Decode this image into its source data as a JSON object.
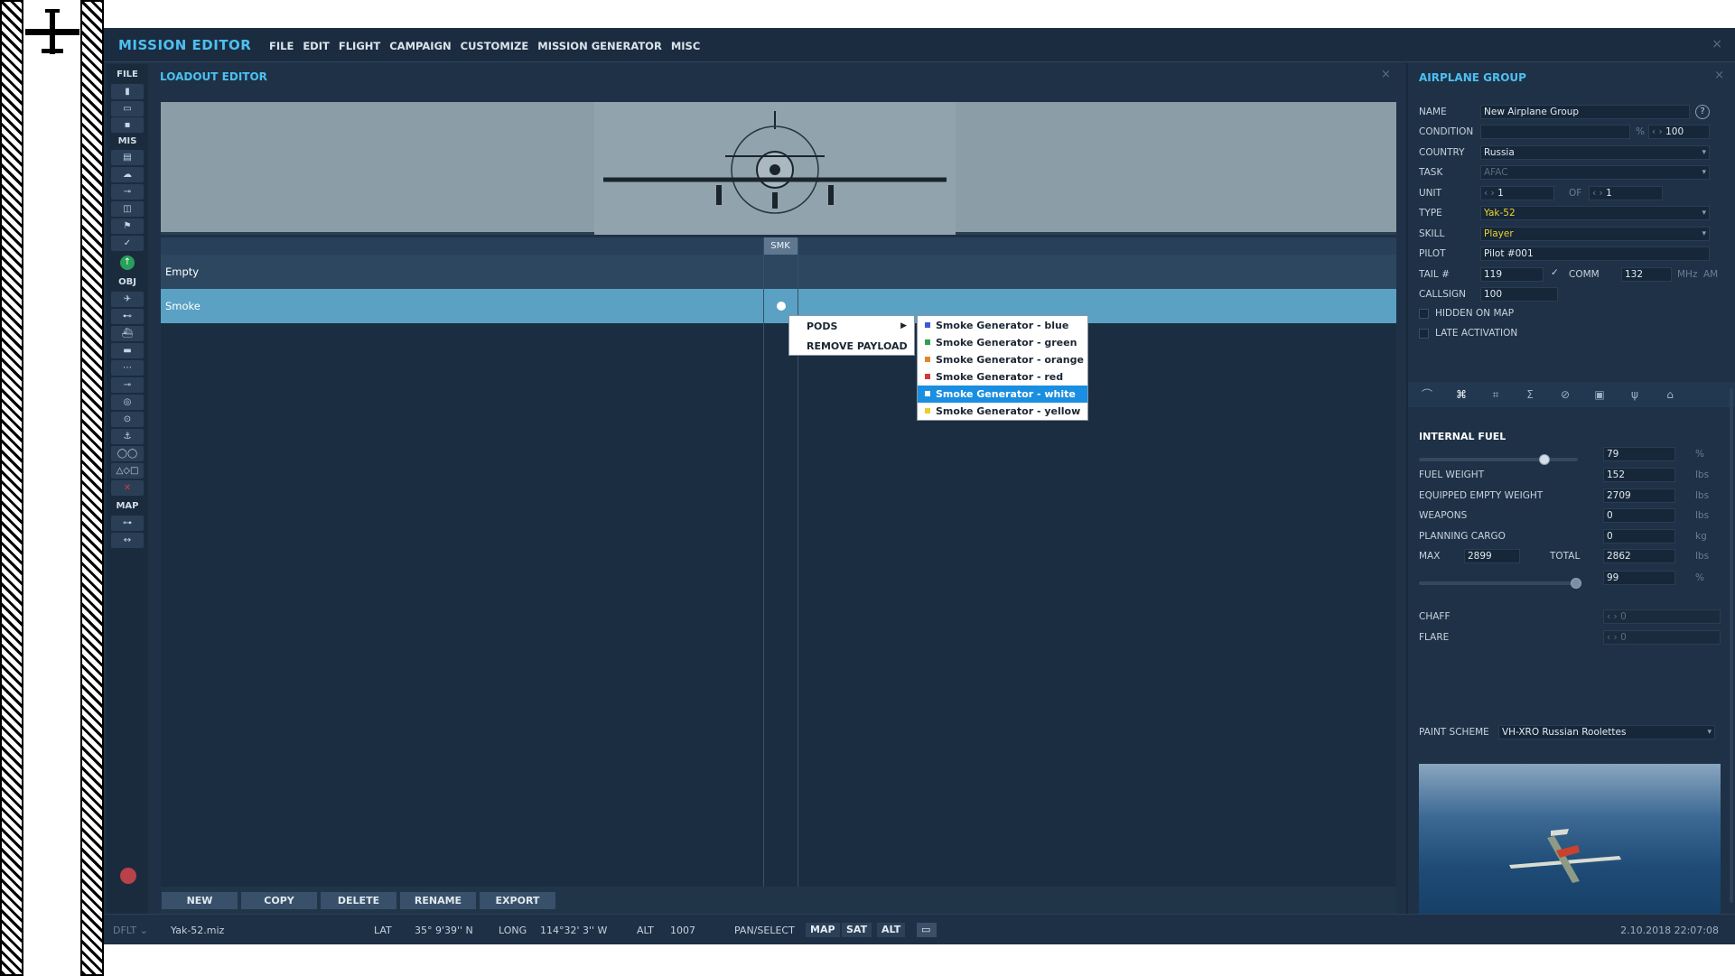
{
  "app": {
    "title": "MISSION EDITOR",
    "menu": [
      "FILE",
      "EDIT",
      "FLIGHT",
      "CAMPAIGN",
      "CUSTOMIZE",
      "MISSION GENERATOR",
      "MISC"
    ],
    "close_glyph": "×"
  },
  "toolbar": {
    "sections": [
      "FILE",
      "MIS",
      "OBJ",
      "MAP"
    ],
    "icons": [
      "new-file-icon",
      "open-file-icon",
      "save-file-icon",
      "briefing-icon",
      "weather-icon",
      "triggers-icon",
      "trigger-zone-icon",
      "goals-icon",
      "check-icon",
      "go-icon",
      "plane-icon",
      "helicopter-icon",
      "ship-icon",
      "vehicle-icon",
      "convoy-icon",
      "static-icon",
      "target-icon",
      "point-icon",
      "nav-point-icon",
      "template-icon",
      "shapes-icon",
      "delete-icon",
      "key-icon",
      "ruler-icon"
    ]
  },
  "loadout": {
    "title": "LOADOUT EDITOR",
    "column": "SMK",
    "rows": [
      "Empty",
      "Smoke"
    ],
    "context_menu": [
      {
        "label": "PODS",
        "has_submenu": true
      },
      {
        "label": "REMOVE PAYLOAD",
        "has_submenu": false
      }
    ],
    "submenu": [
      {
        "label": "Smoke Generator - blue",
        "color": "#3a5bd9",
        "selected": false
      },
      {
        "label": "Smoke Generator - green",
        "color": "#2fa04a",
        "selected": false
      },
      {
        "label": "Smoke Generator - orange",
        "color": "#e5852a",
        "selected": false
      },
      {
        "label": "Smoke Generator - red",
        "color": "#d23a3a",
        "selected": false
      },
      {
        "label": "Smoke Generator - white",
        "color": "#ffffff",
        "selected": true
      },
      {
        "label": "Smoke Generator - yellow",
        "color": "#e8cf2c",
        "selected": false
      }
    ],
    "buttons": [
      "NEW",
      "COPY",
      "DELETE",
      "RENAME",
      "EXPORT"
    ]
  },
  "status": {
    "mode": "DFLT",
    "file": "Yak-52.miz",
    "lat_label": "LAT",
    "lat": "35° 9'39'' N",
    "long_label": "LONG",
    "long": "114°32' 3'' W",
    "alt_label": "ALT",
    "alt": "1007",
    "pan_select": "PAN/SELECT",
    "map_buttons": [
      "MAP",
      "SAT",
      "ALT"
    ],
    "datetime": "2.10.2018 22:07:08"
  },
  "group": {
    "title": "AIRPLANE GROUP",
    "help": "?",
    "name_label": "NAME",
    "name": "New Airplane Group",
    "condition_label": "CONDITION",
    "condition_unit": "%",
    "condition_value": "100",
    "country_label": "COUNTRY",
    "country": "Russia",
    "task_label": "TASK",
    "task": "AFAC",
    "unit_label": "UNIT",
    "unit": "1",
    "of_label": "OF",
    "of": "1",
    "type_label": "TYPE",
    "type": "Yak-52",
    "skill_label": "SKILL",
    "skill": "Player",
    "pilot_label": "PILOT",
    "pilot": "Pilot #001",
    "tail_label": "TAIL #",
    "tail": "119",
    "comm_label": "COMM",
    "comm": "132",
    "comm_unit": "MHz",
    "comm_mod": "AM",
    "callsign_label": "CALLSIGN",
    "callsign": "100",
    "hidden_label": "HIDDEN ON MAP",
    "late_label": "LATE ACTIVATION",
    "tab_icons": [
      "route-icon",
      "loadout-icon",
      "waypoint-icon",
      "summary-icon",
      "forbidden-icon",
      "camera-icon",
      "radio-icon",
      "livery-icon"
    ],
    "fuel": {
      "title": "INTERNAL FUEL",
      "percent": "79",
      "percent_unit": "%",
      "fuel_weight_label": "FUEL WEIGHT",
      "fuel_weight": "152",
      "empty_weight_label": "EQUIPPED EMPTY WEIGHT",
      "empty_weight": "2709",
      "weapons_label": "WEAPONS",
      "weapons": "0",
      "cargo_label": "PLANNING CARGO",
      "cargo": "0",
      "max_label": "MAX",
      "max": "2899",
      "total_label": "TOTAL",
      "total": "2862",
      "total_percent": "99",
      "lbs": "lbs",
      "kg": "kg",
      "fuel_fraction": 0.79,
      "total_fraction": 0.99
    },
    "chaff_label": "CHAFF",
    "chaff": "0",
    "flare_label": "FLARE",
    "flare": "0",
    "paint_label": "PAINT SCHEME",
    "paint": "VH-XRO Russian Roolettes"
  }
}
